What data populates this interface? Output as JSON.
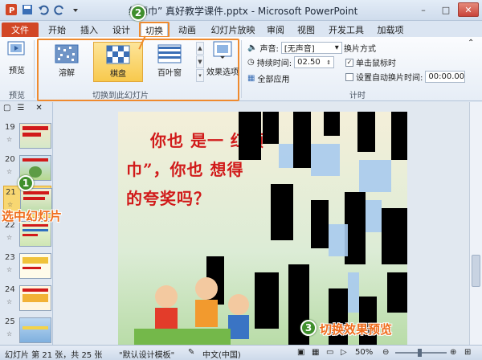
{
  "window": {
    "title": "红领巾” 真好教学课件.pptx - Microsoft PowerPoint",
    "controls": [
      "–",
      "□",
      "✕"
    ]
  },
  "tabs": [
    "文件",
    "开始",
    "插入",
    "设计",
    "切换",
    "动画",
    "幻灯片放映",
    "审阅",
    "视图",
    "开发工具",
    "加载项"
  ],
  "ribbon": {
    "preview_label": "预览",
    "preview_group": "预览",
    "gallery_items": [
      "溶解",
      "棋盘",
      "百叶窗"
    ],
    "gallery_group": "切换到此幻灯片",
    "effect_label": "效果选项",
    "sound_label": "声音:",
    "sound_value": "[无声音]",
    "duration_label": "持续时间:",
    "duration_value": "02.50",
    "apply_all_label": "全部应用",
    "advance_label": "换片方式",
    "on_click_label": "单击鼠标时",
    "on_click_checked": true,
    "auto_after_label": "设置自动换片时间:",
    "auto_after_checked": false,
    "auto_after_value": "00:00.00",
    "timing_group": "计时"
  },
  "slides_panel": {
    "slides": [
      {
        "num": "19"
      },
      {
        "num": "20"
      },
      {
        "num": "21",
        "selected": true
      },
      {
        "num": "22"
      },
      {
        "num": "23"
      },
      {
        "num": "24"
      },
      {
        "num": "25"
      }
    ]
  },
  "slide": {
    "line1": "你也 是一 红领",
    "line2": "巾”，你也 想得",
    "line3": "的夸奖吗？"
  },
  "annotations": {
    "badge1": "1",
    "badge2": "2",
    "badge3": "3",
    "select_text": "选中幻灯片",
    "preview_text": "切换效果预览"
  },
  "status": {
    "slide_info": "幻灯片 第 21 张，共 25 张",
    "theme": "\"默认设计模板\"",
    "language": "中文(中国)",
    "zoom": "50%"
  },
  "colors": {
    "accent": "#ef8a2e",
    "file_tab": "#d24726",
    "slide_text": "#d11a1a",
    "badge": "#3f8f2c"
  }
}
